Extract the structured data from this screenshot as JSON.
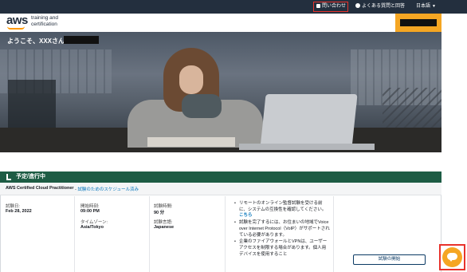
{
  "topbar": {
    "contact_label": "問い合わせ",
    "faq_label": "よくある質問と回答",
    "language_label": "日本語"
  },
  "logo": {
    "brand": "aws",
    "line1": "training and",
    "line2": "certification"
  },
  "hero": {
    "welcome": "ようこそ、XXXさん"
  },
  "section": {
    "title": "予定/進行中"
  },
  "exam": {
    "name": "AWS Certified Cloud Practitioner",
    "separator": " - ",
    "status": "試験のためのスケジュール済み",
    "date_label": "試験日:",
    "date_value": "Feb 28, 2022",
    "start_label": "開始時刻:",
    "start_value": "09:00 PM",
    "tz_label": "タイムゾーン:",
    "tz_value": "Asia/Tokyo",
    "duration_label": "試験時間:",
    "duration_value": "90 分",
    "lang_label": "試験言語:",
    "lang_value": "Japanese",
    "req1_text": "リモートのオンライン監督試験を受ける前に、システムの互換性を確認してください。",
    "req1_link": "こちら",
    "req2_text": "試験を完了するには、お住まいの地域でVoice over Internet Protocol（VoIP）がサポートされている必要があります。",
    "req3_text": "企業のファイアウォールとVPNは、ユーザーアクセスを制限する場合があります。個人用デバイスを使用すること",
    "start_button": "試験の開始"
  },
  "icons": {
    "contact": "phone-icon",
    "faq": "question-circle-icon",
    "language": "chevron-down-icon",
    "section": "hand-icon",
    "chat": "chat-bubble-icon"
  },
  "colors": {
    "topbar": "#232f3e",
    "accent_orange": "#f5a623",
    "section_green": "#1d5c44",
    "link_blue": "#0073bb",
    "highlight_red": "#e8322b"
  }
}
